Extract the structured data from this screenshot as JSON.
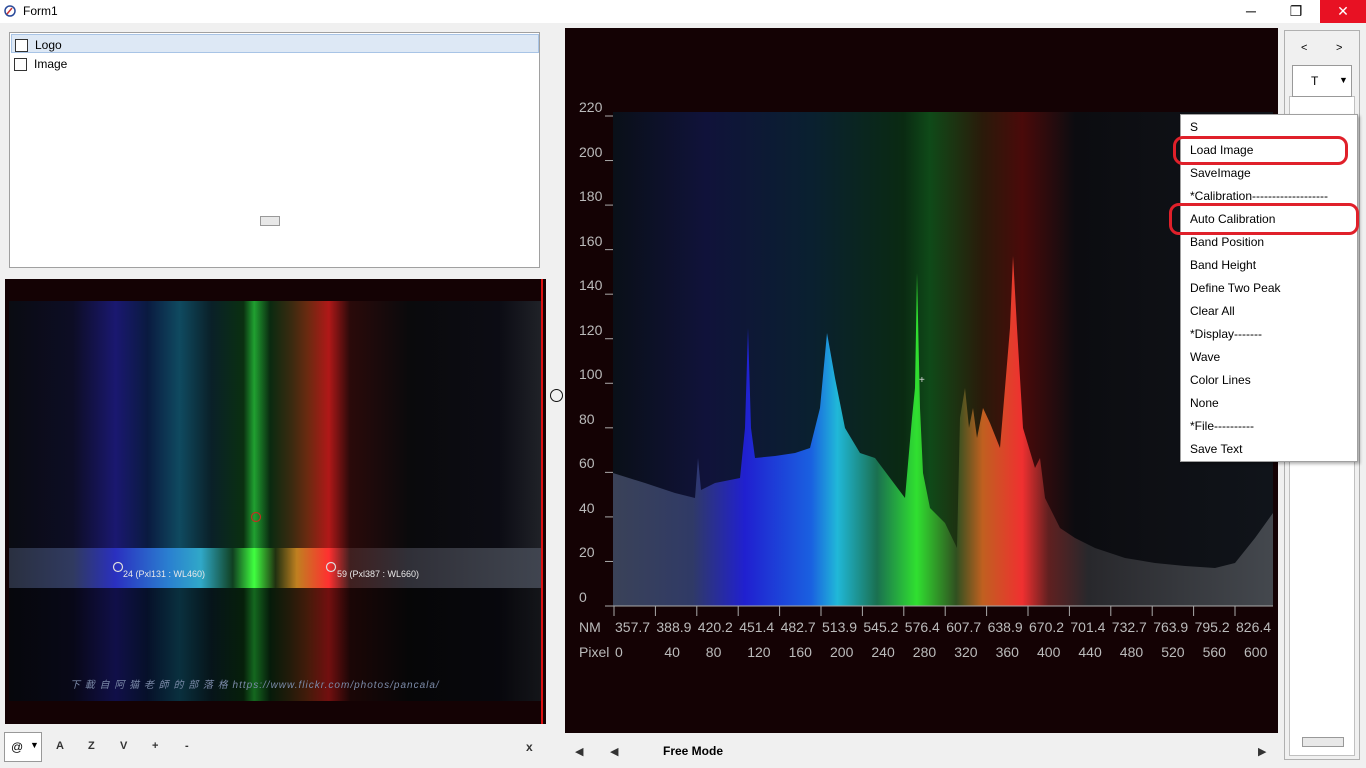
{
  "window": {
    "title": "Form1",
    "min": "─",
    "max": "❐",
    "close": "✕"
  },
  "checklist": {
    "items": [
      {
        "label": "Logo"
      },
      {
        "label": "Image"
      }
    ]
  },
  "image_panel": {
    "band_labels": [
      "24 (Pxl131 : WL460)",
      "59 (Pxl387 : WL660)"
    ],
    "watermark": "下 載 自 阿 猫 老 師 的 部 落 格 https://www.flickr.com/photos/pancala/"
  },
  "left_toolbar": {
    "combo_value": "@",
    "buttons": [
      "A",
      "Z",
      "V",
      "+",
      "-"
    ],
    "close": "x"
  },
  "spectrum": {
    "y_ticks": [
      "220",
      "200",
      "180",
      "160",
      "140",
      "120",
      "100",
      "80",
      "60",
      "40",
      "20",
      "0"
    ],
    "nm_label": "NM",
    "nm_values": [
      "357.7",
      "388.9",
      "420.2",
      "451.4",
      "482.7",
      "513.9",
      "545.2",
      "576.4",
      "607.7",
      "638.9",
      "670.2",
      "701.4",
      "732.7",
      "763.9",
      "795.2",
      "826.4"
    ],
    "pixel_label": "Pixel",
    "pixel_values": [
      "0",
      "40",
      "80",
      "120",
      "160",
      "200",
      "240",
      "280",
      "320",
      "360",
      "400",
      "440",
      "480",
      "520",
      "560",
      "600"
    ]
  },
  "bottom_nav": {
    "first": "◀",
    "prev": "◀",
    "mode": "Free Mode",
    "next": "▶"
  },
  "side_panel": {
    "prev": "<",
    "next": ">",
    "combo_value": "T"
  },
  "context_menu": {
    "items": [
      "S",
      "Load Image",
      "SaveImage",
      "*Calibration-------------------",
      "Auto Calibration",
      "Band Position",
      "Band Height",
      "Define Two Peak",
      "Clear All",
      "*Display-------",
      "Wave",
      "Color Lines",
      "None",
      "*File----------",
      "Save Text"
    ],
    "highlighted": [
      "Load Image",
      "Auto Calibration"
    ]
  }
}
